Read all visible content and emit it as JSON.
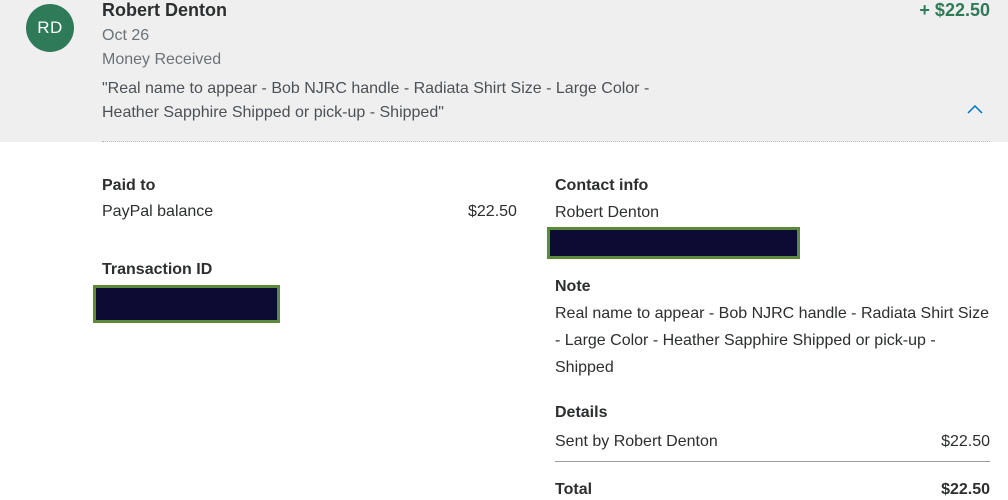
{
  "transaction": {
    "avatar_initials": "RD",
    "name": "Robert Denton",
    "date": "Oct 26",
    "type": "Money Received",
    "memo": "\"Real name to appear - Bob NJRC handle - Radiata Shirt Size - Large Color - Heather Sapphire Shipped or pick-up - Shipped\"",
    "amount": "+ $22.50"
  },
  "paid_to": {
    "label": "Paid to",
    "method": "PayPal balance",
    "amount": "$22.50"
  },
  "transaction_id": {
    "label": "Transaction ID"
  },
  "contact": {
    "label": "Contact info",
    "name": "Robert Denton"
  },
  "note": {
    "label": "Note",
    "text": "Real name to appear - Bob NJRC handle - Radiata Shirt Size - Large Color - Heather Sapphire Shipped or pick-up - Shipped"
  },
  "details": {
    "label": "Details",
    "sent_by_label": "Sent by Robert Denton",
    "sent_by_amount": "$22.50",
    "total_label": "Total",
    "total_amount": "$22.50"
  },
  "colors": {
    "avatar": "#2f7a58",
    "positive_amount": "#2f7a58",
    "redaction_fill": "#0d0a33",
    "redaction_border": "#5b8a3c",
    "header_bg": "#efefef"
  },
  "icons": {
    "collapse": "chevron-up-icon"
  }
}
